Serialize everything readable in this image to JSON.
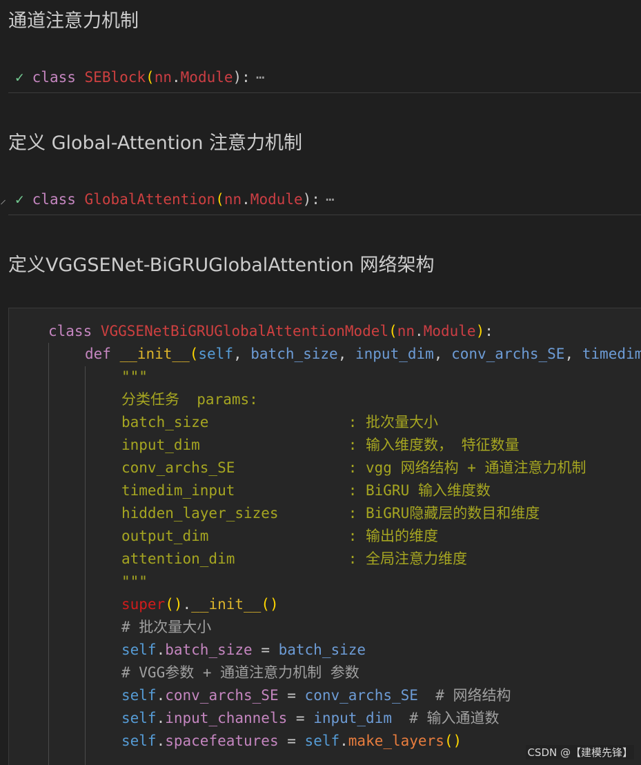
{
  "sections": {
    "se_heading": "通道注意力机制",
    "se_cell": {
      "kw": "class",
      "name": "SEBlock",
      "open": "(",
      "base_mod": "nn",
      "dot": ".",
      "base_cls": "Module",
      "close": "):",
      "ellipsis": "⋯"
    },
    "ga_heading": "定义 Global-Attention 注意力机制",
    "ga_cell": {
      "kw": "class",
      "name": "GlobalAttention",
      "open": "(",
      "base_mod": "nn",
      "dot": ".",
      "base_cls": "Module",
      "close": "):",
      "ellipsis": "⋯"
    },
    "net_heading": "定义VGGSENet-BiGRUGlobalAttention 网络架构"
  },
  "code": {
    "l1": {
      "kw": "class ",
      "name": "VGGSENetBiGRUGlobalAttentionModel",
      "open": "(",
      "mod": "nn",
      "dot": ".",
      "cls": "Module",
      "close": ")",
      "colon": ":"
    },
    "l2": {
      "kw": "def ",
      "fn": "__init__",
      "open": "(",
      "p1": "self",
      "c1": ", ",
      "p2": "batch_size",
      "c2": ", ",
      "p3": "input_dim",
      "c3": ", ",
      "p4": "conv_archs_SE",
      "c4": ", ",
      "p5": "timedim"
    },
    "l3": "\"\"\"",
    "l4": "分类任务  params:",
    "l5": "batch_size                : 批次量大小",
    "l6": "input_dim                 : 输入维度数， 特征数量",
    "l7": "conv_archs_SE             : vgg 网络结构 + 通道注意力机制",
    "l8": "timedim_input             : BiGRU 输入维度数",
    "l9": "hidden_layer_sizes        : BiGRU隐藏层的数目和维度",
    "l10": "output_dim                : 输出的维度",
    "l11": "attention_dim             : 全局注意力维度",
    "l12": "\"\"\"",
    "l13": {
      "sup": "super",
      "p1": "()",
      "dot": ".",
      "init": "__init__",
      "p2": "()"
    },
    "l14": "# 批次量大小",
    "l15": {
      "self": "self",
      "dot": ".",
      "attr": "batch_size",
      "eq": " = ",
      "val": "batch_size"
    },
    "l16": "# VGG参数 + 通道注意力机制 参数",
    "l17": {
      "self": "self",
      "dot": ".",
      "attr": "conv_archs_SE",
      "eq": " = ",
      "val": "conv_archs_SE",
      "cmt": "  # 网络结构"
    },
    "l18": {
      "self": "self",
      "dot": ".",
      "attr": "input_channels",
      "eq": " = ",
      "val": "input_dim",
      "cmt": "  # 输入通道数"
    },
    "l19": {
      "self": "self",
      "dot": ".",
      "attr": "spacefeatures",
      "eq": " = ",
      "self2": "self",
      "dot2": ".",
      "fn": "make_layers",
      "call": "()"
    }
  },
  "watermark": "CSDN @【建模先锋】"
}
